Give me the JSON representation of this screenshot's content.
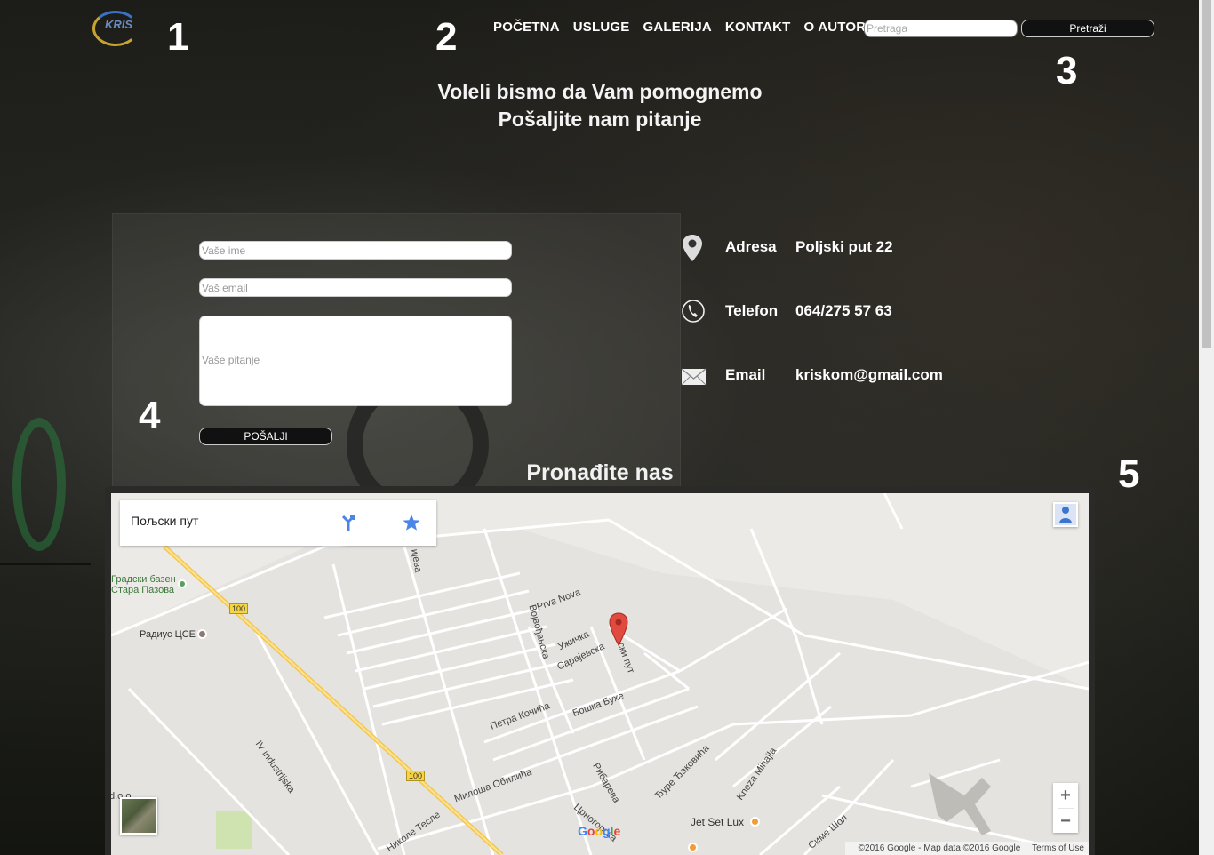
{
  "header": {
    "logo_text": "KRIS",
    "numbers": [
      "1",
      "2",
      "3",
      "4",
      "5"
    ],
    "nav": [
      "POČETNA",
      "USLUGE",
      "GALERIJA",
      "KONTAKT",
      "O AUTORU"
    ],
    "search": {
      "placeholder": "Pretraga",
      "button": "Pretraži"
    }
  },
  "headline": {
    "line1": "Voleli bismo da Vam pomognemo",
    "line2": "Pošaljite nam pitanje"
  },
  "form": {
    "name_placeholder": "Vaše ime",
    "email_placeholder": "Vaš email",
    "question_placeholder": "Vaše pitanje",
    "send_label": "POŠALJI"
  },
  "contact": {
    "address": {
      "label": "Adresa",
      "value": "Poljski put 22",
      "icon": "location-pin-icon"
    },
    "phone": {
      "label": "Telefon",
      "value": "064/275 57 63",
      "icon": "phone-icon"
    },
    "email": {
      "label": "Email",
      "value": "kriskom@gmail.com",
      "icon": "envelope-icon"
    }
  },
  "map": {
    "title": "Pronađite nas",
    "place_name": "Пољски пут",
    "labels": {
      "pool": "Градски базен",
      "pool2": "Стара Пазова",
      "radius": "Радиус ЦСЕ",
      "prva_nova": "Prva Nova",
      "vojvodjanska": "Војвођанска",
      "uzicka": "Ужичка",
      "sarajevska": "Сарајевска",
      "poljski": "Пољски пут",
      "petra": "Петра Кочића",
      "boska": "Бошка Бухе",
      "milosa": "Милоша Обилића",
      "ribareva": "Рибарева",
      "djure": "Ђуре Ђаковића",
      "kneza": "Kneza Mihajla",
      "industrijska": "IV industrijska",
      "tesle": "Николе Тесле",
      "crnogorska": "Црногорска",
      "jetset": "Jet Set Lux",
      "sime": "Симе Шол",
      "ieva": "ијева",
      "doo": "d.o.o."
    },
    "road_number": "100",
    "google": "Google",
    "footer_copyright": "©2016 Google - Map data ©2016 Google",
    "footer_terms": "Terms of Use",
    "zoom_in": "+",
    "zoom_out": "−"
  }
}
